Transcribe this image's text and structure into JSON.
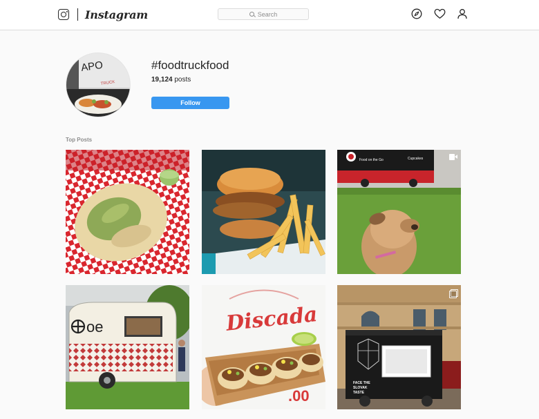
{
  "header": {
    "wordmark": "Instagram",
    "search_placeholder": "Search",
    "icons": [
      "instagram-glyph",
      "compass-icon",
      "heart-icon",
      "profile-icon"
    ]
  },
  "hashtag": {
    "title": "#foodtruckfood",
    "post_count": "19,124",
    "post_count_suffix": " posts",
    "follow_label": "Follow"
  },
  "sections": {
    "top_posts_label": "Top Posts"
  },
  "posts": [
    {
      "kind": "single",
      "subject": "arepa-in-checkered-tray"
    },
    {
      "kind": "single",
      "subject": "chicken-sandwich-with-fries"
    },
    {
      "kind": "video",
      "subject": "dog-near-food-truck"
    },
    {
      "kind": "single",
      "subject": "vintage-trailer",
      "sign_text": "oe"
    },
    {
      "kind": "single",
      "subject": "tacos",
      "sign_text": "Discada"
    },
    {
      "kind": "multi",
      "subject": "food-truck-in-square",
      "sign_text": "FACE THE SLOVAK TASTE"
    }
  ],
  "colors": {
    "accent": "#3897f0",
    "text": "#262626",
    "muted": "#8e8e8e",
    "border": "#dbdbdb",
    "background": "#fafafa"
  }
}
